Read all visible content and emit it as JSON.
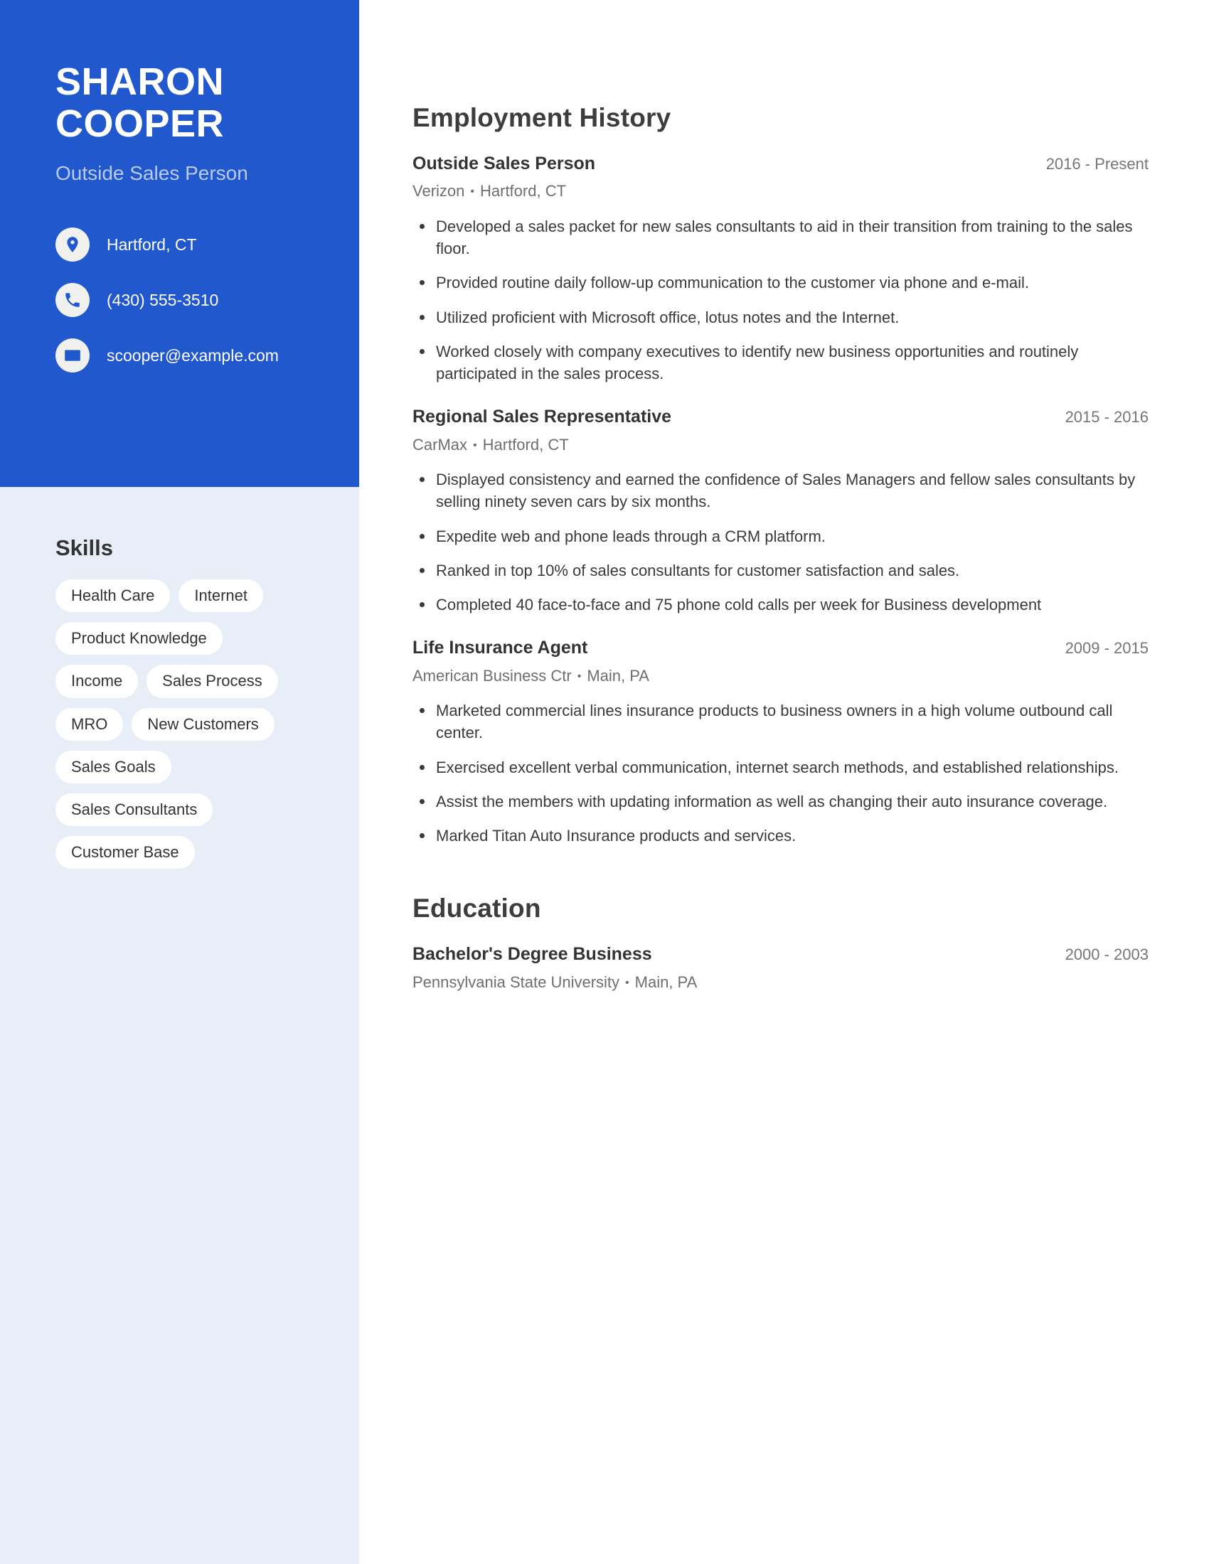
{
  "profile": {
    "first_name": "SHARON",
    "last_name": "COOPER",
    "job_title": "Outside Sales Person"
  },
  "colors": {
    "accent_blue": "#2158CE",
    "sidebar_light": "#E8EEF8",
    "subtitle_blue": "#B9CBEB",
    "heading_dark": "#3D3D3D",
    "body_gray": "#3A3A3A",
    "muted_gray": "#767676"
  },
  "contact": [
    {
      "icon": "location-pin-icon",
      "value": "Hartford, CT"
    },
    {
      "icon": "phone-icon",
      "value": "(430) 555-3510"
    },
    {
      "icon": "email-envelope-icon",
      "value": "scooper@example.com"
    }
  ],
  "skills": {
    "heading": "Skills",
    "items": [
      "Health Care",
      "Internet",
      "Product Knowledge",
      "Income",
      "Sales Process",
      "MRO",
      "New Customers",
      "Sales Goals",
      "Sales Consultants",
      "Customer Base"
    ]
  },
  "employment": {
    "heading": "Employment History",
    "separator": "•",
    "entries": [
      {
        "title": "Outside Sales Person",
        "dates": "2016 - Present",
        "company": "Verizon",
        "location": "Hartford, CT",
        "bullets": [
          "Developed a sales packet for new sales consultants to aid in their transition from training to the sales floor.",
          "Provided routine daily follow-up communication to the customer via phone and e-mail.",
          "Utilized proficient with Microsoft office, lotus notes and the Internet.",
          "Worked closely with company executives to identify new business opportunities and routinely participated in the sales process."
        ]
      },
      {
        "title": "Regional Sales Representative",
        "dates": "2015 - 2016",
        "company": "CarMax",
        "location": "Hartford, CT",
        "bullets": [
          "Displayed consistency and earned the confidence of Sales Managers and fellow sales consultants by selling ninety seven cars by six months.",
          "Expedite web and phone leads through a CRM platform.",
          "Ranked in top 10% of sales consultants for customer satisfaction and sales.",
          "Completed 40 face-to-face and 75 phone cold calls per week for Business development"
        ]
      },
      {
        "title": "Life Insurance Agent",
        "dates": "2009 - 2015",
        "company": "American Business Ctr",
        "location": "Main, PA",
        "bullets": [
          "Marketed commercial lines insurance products to business owners in a high volume outbound call center.",
          "Exercised excellent verbal communication, internet search methods, and established relationships.",
          "Assist the members with updating information as well as changing their auto insurance coverage.",
          "Marked Titan Auto Insurance products and services."
        ]
      }
    ]
  },
  "education": {
    "heading": "Education",
    "separator": "•",
    "entries": [
      {
        "title": "Bachelor's Degree Business",
        "dates": "2000 - 2003",
        "school": "Pennsylvania State University",
        "location": "Main, PA"
      }
    ]
  }
}
